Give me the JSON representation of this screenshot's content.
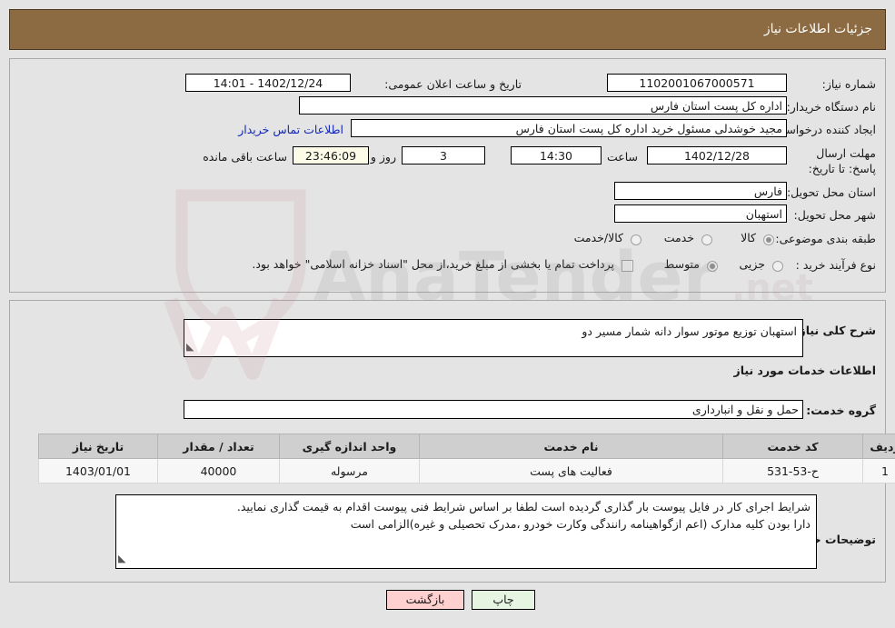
{
  "header": {
    "title": "جزئیات اطلاعات نیاز"
  },
  "watermark": {
    "text": "AnaTender.net"
  },
  "form": {
    "need_number_label": "شماره نیاز:",
    "need_number_value": "1102001067000571",
    "buyer_org_label": "نام دستگاه خریدار:",
    "buyer_org_value": "اداره کل پست استان فارس",
    "requester_label": "ایجاد کننده درخواست:",
    "requester_value": "مجید خوشدلی مسئول خرید اداره کل پست استان فارس",
    "contact_link": "اطلاعات تماس خریدار",
    "deadline_label": "مهلت ارسال پاسخ: تا تاریخ:",
    "deadline_date": "1402/12/28",
    "time_label": "ساعت",
    "deadline_time": "14:30",
    "days_value": "3",
    "days_label": "روز و",
    "countdown_value": "23:46:09",
    "countdown_label": "ساعت باقی مانده",
    "announce_label": "تاریخ و ساعت اعلان عمومی:",
    "announce_value": "1402/12/24 - 14:01",
    "province_label": "استان محل تحویل:",
    "province_value": "فارس",
    "city_label": "شهر محل تحویل:",
    "city_value": "استهبان",
    "category_label": "طبقه بندی موضوعی:",
    "category_options": [
      {
        "label": "کالا",
        "selected": false
      },
      {
        "label": "خدمت",
        "selected": true
      },
      {
        "label": "کالا/خدمت",
        "selected": false
      }
    ],
    "process_label": "نوع فرآیند خرید :",
    "process_options": [
      {
        "label": "جزیی",
        "selected": false
      },
      {
        "label": "متوسط",
        "selected": true
      }
    ],
    "treasury_checkbox_label": "پرداخت تمام یا بخشی از مبلغ خرید،از محل \"اسناد خزانه اسلامی\" خواهد بود.",
    "treasury_checked": false
  },
  "details": {
    "general_desc_label": "شرح کلی نیاز:",
    "general_desc_value": "استهبان توزیع موتور سوار دانه شمار مسیر دو",
    "services_heading": "اطلاعات خدمات مورد نیاز",
    "service_group_label": "گروه خدمت:",
    "service_group_value": "حمل و نقل و انبارداری",
    "notes_label": "توضیحات خریدار:",
    "notes_line1": "شرایط اجرای کار در فایل پیوست بار گذاری گردیده است لطفا بر اساس شرایط فنی پیوست اقدام به قیمت گذاری نمایید.",
    "notes_line2": "دارا بودن کلیه مدارک (اعم ازگواهینامه رانندگی وکارت خودرو ،مدرک تحصیلی و غیره)الزامی است"
  },
  "table": {
    "columns": [
      "ردیف",
      "کد خدمت",
      "نام خدمت",
      "واحد اندازه گیری",
      "تعداد / مقدار",
      "تاریخ نیاز"
    ],
    "rows": [
      {
        "row": "1",
        "code": "ح-53-531",
        "name": "فعالیت های پست",
        "unit": "مرسوله",
        "quantity": "40000",
        "need_date": "1403/01/01"
      }
    ]
  },
  "footer": {
    "back_label": "بازگشت",
    "print_label": "چاپ"
  },
  "colors": {
    "header_bg": "#8c6a42",
    "page_bg": "#e4e4e4",
    "link": "#1128b8",
    "back_btn": "#ffd0d0",
    "print_btn": "#e6f5e2",
    "countdown_bg": "#fbfbe8",
    "table_header_bg": "#cfcfcf"
  }
}
